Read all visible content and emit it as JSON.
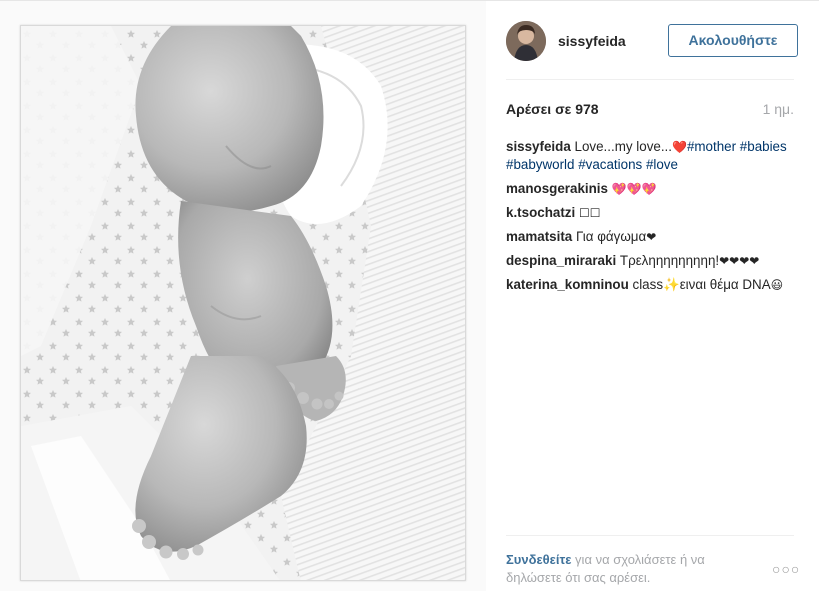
{
  "post": {
    "username": "sissyfeida",
    "follow_label": "Ακολουθήστε",
    "likes_label": "Αρέσει σε 978",
    "time_label": "1 ημ."
  },
  "comments": [
    {
      "user": "sissyfeida",
      "text": "Love...my love...",
      "emoji": "❤️",
      "tags": "#mother #babies #babyworld #vacations #love"
    },
    {
      "user": "manosgerakinis",
      "text": "",
      "emoji": "💖💖💖",
      "tags": ""
    },
    {
      "user": "k.tsochatzi",
      "text": "",
      "emoji": "☐☐",
      "tags": ""
    },
    {
      "user": "mamatsita",
      "text": "Για φάγωμα",
      "emoji": "❤",
      "tags": ""
    },
    {
      "user": "despina_miraraki",
      "text": "Τρεληηηηηηηηη!",
      "emoji": "❤❤❤❤",
      "tags": ""
    },
    {
      "user": "katerina_komninou",
      "text": "class✨ειναι θέμα DNA",
      "emoji": "😃",
      "tags": ""
    }
  ],
  "footer": {
    "login_label": "Συνδεθείτε",
    "rest_text": " για να σχολιάσετε ή να δηλώσετε ότι σας αρέσει.",
    "more_label": "○○○"
  },
  "icons": {
    "avatar": "user-avatar",
    "more": "more-options-icon"
  },
  "colors": {
    "link": "#003569",
    "button": "#3f729b",
    "muted": "#a5a7aa"
  }
}
